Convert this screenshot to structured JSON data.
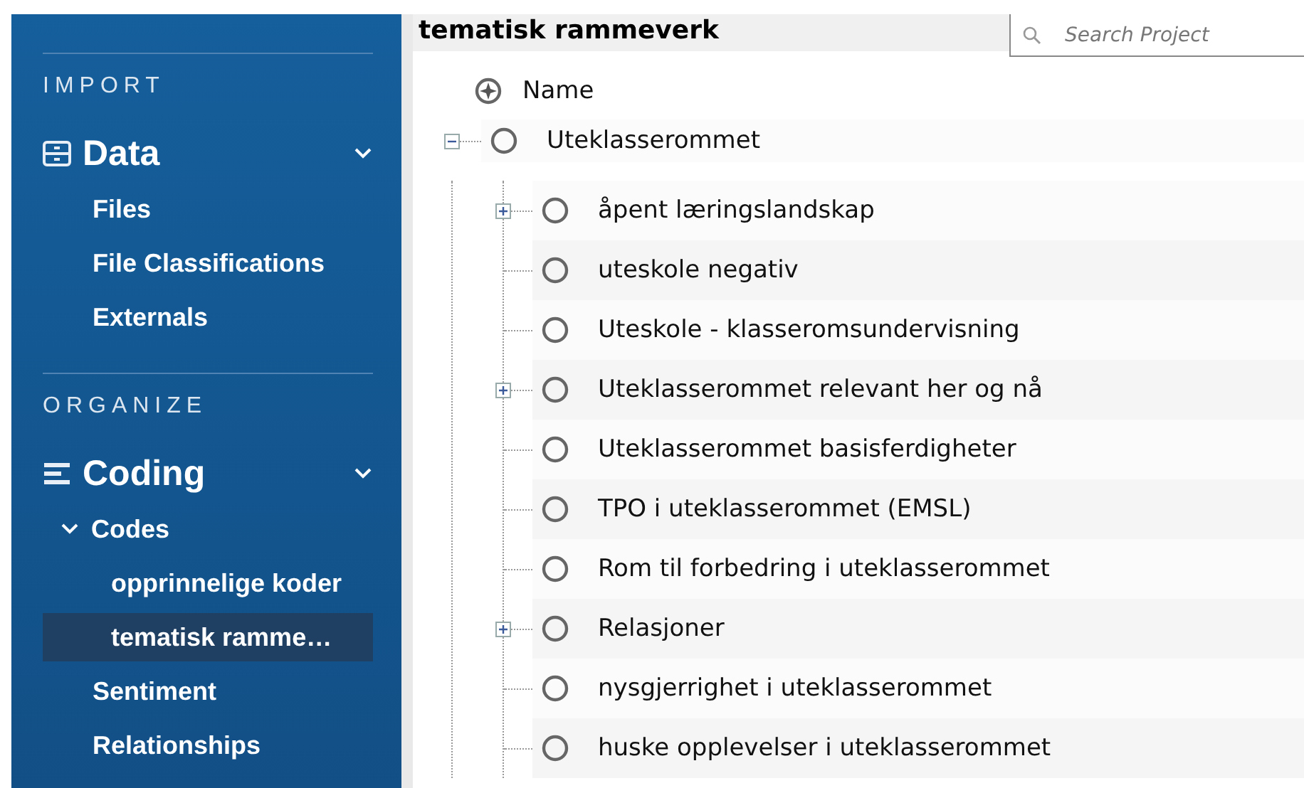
{
  "sidebar": {
    "sections": [
      {
        "heading": "IMPORT",
        "groups": [
          {
            "label": "Data",
            "kind": "data",
            "expanded": true,
            "items": [
              {
                "label": "Files",
                "selected": false
              },
              {
                "label": "File Classifications",
                "selected": false
              },
              {
                "label": "Externals",
                "selected": false
              }
            ]
          }
        ]
      },
      {
        "heading": "ORGANIZE",
        "groups": [
          {
            "label": "Coding",
            "kind": "coding",
            "expanded": true,
            "items": [
              {
                "label": "Codes",
                "selected": false,
                "expanded": true,
                "children": [
                  {
                    "label": "opprinnelige koder",
                    "selected": false
                  },
                  {
                    "label": "tematisk ramme…",
                    "selected": true
                  }
                ]
              },
              {
                "label": "Sentiment",
                "selected": false
              },
              {
                "label": "Relationships",
                "selected": false
              }
            ]
          }
        ]
      }
    ]
  },
  "panel": {
    "title": "tematisk rammeverk",
    "search": {
      "placeholder": "Search Project"
    },
    "column": "Name",
    "tree": [
      {
        "name": "Uteklasserommet",
        "expanded": true,
        "children": [
          {
            "name": "åpent læringslandskap",
            "expanded": false
          },
          {
            "name": "uteskole negativ"
          },
          {
            "name": "Uteskole - klasseromsundervisning"
          },
          {
            "name": "Uteklasserommet relevant her og nå",
            "expanded": false
          },
          {
            "name": "Uteklasserommet basisferdigheter"
          },
          {
            "name": "TPO i uteklasserommet (EMSL)"
          },
          {
            "name": "Rom til forbedring i uteklasserommet"
          },
          {
            "name": "Relasjoner",
            "expanded": false
          },
          {
            "name": "nysgjerrighet i uteklasserommet"
          },
          {
            "name": "huske opplevelser i uteklasserommet"
          }
        ]
      }
    ]
  }
}
